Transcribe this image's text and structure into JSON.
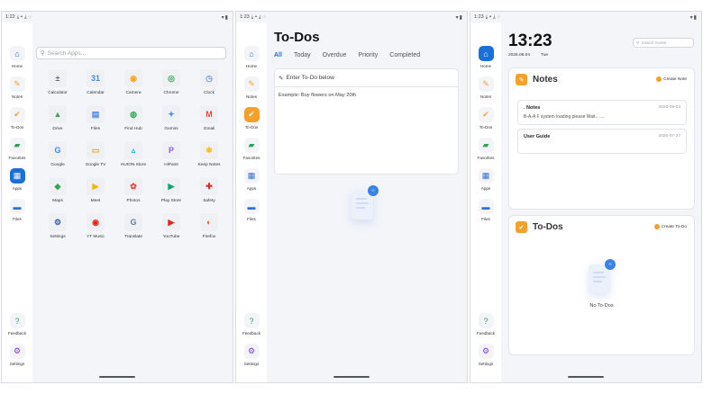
{
  "screens": [
    {
      "status_time": "1:22"
    },
    {
      "status_time": "1:23"
    },
    {
      "status_time": "1:23"
    }
  ],
  "rail": {
    "home": "Home",
    "notes": "Notes",
    "todos": "To-Dos",
    "favorites": "Favorites",
    "apps": "Apps",
    "files": "Files",
    "feedback": "Feedback",
    "settings": "Settings"
  },
  "apps_screen": {
    "search_placeholder": "Search Apps...",
    "apps": [
      {
        "label": "Calculator",
        "glyph": "±",
        "color": "#5f6b7a"
      },
      {
        "label": "Calendar",
        "glyph": "31",
        "color": "#4a86e8"
      },
      {
        "label": "Camera",
        "glyph": "◉",
        "color": "#f4a521"
      },
      {
        "label": "Chrome",
        "glyph": "◎",
        "color": "#34a853"
      },
      {
        "label": "Clock",
        "glyph": "◷",
        "color": "#6e9be0"
      },
      {
        "label": "Drive",
        "glyph": "▲",
        "color": "#34a853"
      },
      {
        "label": "Files",
        "glyph": "▤",
        "color": "#4a86e8"
      },
      {
        "label": "Find Hub",
        "glyph": "◍",
        "color": "#34a853"
      },
      {
        "label": "Gemini",
        "glyph": "✦",
        "color": "#5b8def"
      },
      {
        "label": "Gmail",
        "glyph": "M",
        "color": "#ea4335"
      },
      {
        "label": "Google",
        "glyph": "G",
        "color": "#4285f4"
      },
      {
        "label": "Google TV",
        "glyph": "▭",
        "color": "#e8a21b"
      },
      {
        "label": "HUION Store",
        "glyph": "▵",
        "color": "#18b6c9"
      },
      {
        "label": "HiPaint",
        "glyph": "P",
        "color": "#8a5cf6"
      },
      {
        "label": "Keep Notes",
        "glyph": "✱",
        "color": "#f6c026"
      },
      {
        "label": "Maps",
        "glyph": "◆",
        "color": "#34a853"
      },
      {
        "label": "Meet",
        "glyph": "▶",
        "color": "#f4b400"
      },
      {
        "label": "Photos",
        "glyph": "✿",
        "color": "#ea4335"
      },
      {
        "label": "Play Store",
        "glyph": "▶",
        "color": "#00a86b"
      },
      {
        "label": "Safety",
        "glyph": "✚",
        "color": "#d93025"
      },
      {
        "label": "Settings",
        "glyph": "⚙",
        "color": "#3b5ea8"
      },
      {
        "label": "YT Music",
        "glyph": "◉",
        "color": "#e62117"
      },
      {
        "label": "Translate",
        "glyph": "G",
        "color": "#5f7ea9"
      },
      {
        "label": "YouTube",
        "glyph": "▶",
        "color": "#e62117"
      },
      {
        "label": "Firefox",
        "glyph": "◐",
        "color": "#f05a24"
      }
    ]
  },
  "todos_screen": {
    "title": "To-Dos",
    "tabs": [
      "All",
      "Today",
      "Overdue",
      "Priority",
      "Completed"
    ],
    "active_tab": "All",
    "input_placeholder": "Enter To-Do below",
    "example": "Example: Buy flowers on May 20th"
  },
  "home_screen": {
    "time": "13:23",
    "date": "2026.08.04",
    "weekday": "Tue",
    "search_placeholder": "Search Notes",
    "notes_panel": {
      "title": "Notes",
      "action": "Create Note",
      "items": [
        {
          "title": ". Notes",
          "date": "2026-08-03",
          "preview": "B-A-A F system loading please Wait... ..."
        },
        {
          "title": "User Guide",
          "date": "2026-07-27",
          "preview": ""
        }
      ]
    },
    "todos_panel": {
      "title": "To-Dos",
      "action": "Create To-Do",
      "empty": "No To-Dos"
    }
  },
  "colors": {
    "accent": "#1a6fd9",
    "orange": "#f3a12b",
    "background": "#f3f5f9"
  }
}
